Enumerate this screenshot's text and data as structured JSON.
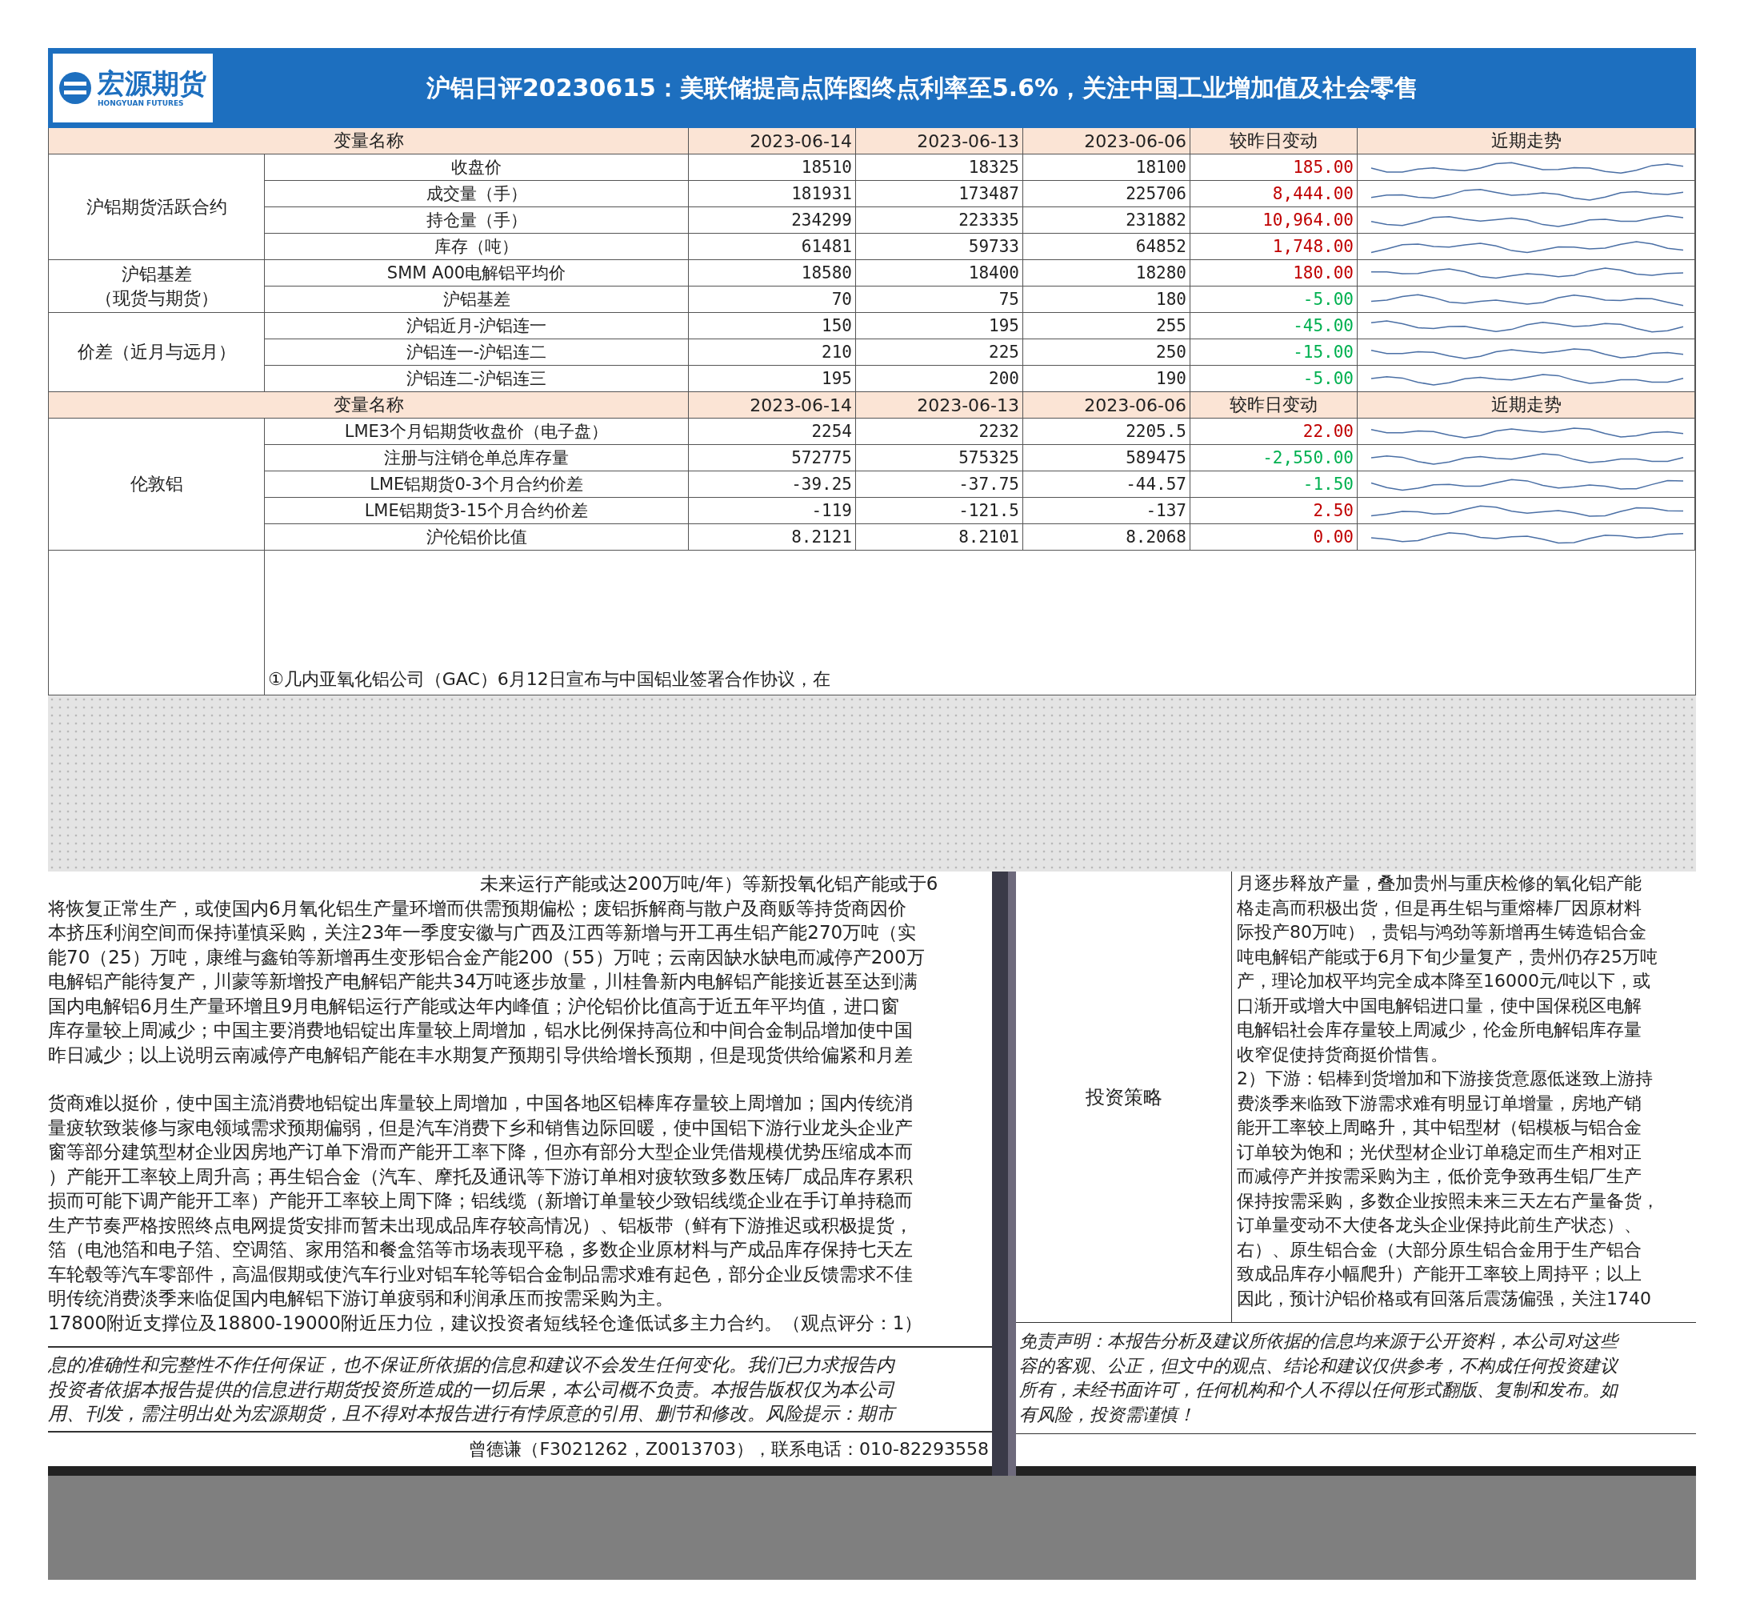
{
  "header": {
    "logo": {
      "name": "宏源期货",
      "subtitle": "HONGYUAN FUTURES"
    },
    "title": "沪铝日评20230615：美联储提高点阵图终点利率至5.6%，关注中国工业增加值及社会零售"
  },
  "sections": [
    {
      "columns": [
        "变量名称",
        "2023-06-14",
        "2023-06-13",
        "2023-06-06",
        "较昨日变动",
        "近期走势"
      ],
      "groups": [
        {
          "label": [
            "沪铝期货活跃合约"
          ],
          "rows": [
            {
              "name": "收盘价",
              "values": [
                "18510",
                "18325",
                "18100"
              ],
              "change": "185.00",
              "color": "#c00000"
            },
            {
              "name": "成交量（手）",
              "values": [
                "181931",
                "173487",
                "225706"
              ],
              "change": "8,444.00",
              "color": "#c00000"
            },
            {
              "name": "持仓量（手）",
              "values": [
                "234299",
                "223335",
                "231882"
              ],
              "change": "10,964.00",
              "color": "#c00000"
            },
            {
              "name": "库存（吨）",
              "values": [
                "61481",
                "59733",
                "64852"
              ],
              "change": "1,748.00",
              "color": "#c00000"
            }
          ]
        },
        {
          "label": [
            "沪铝基差",
            "（现货与期货）"
          ],
          "rows": [
            {
              "name": "SMM A00电解铝平均价",
              "values": [
                "18580",
                "18400",
                "18280"
              ],
              "change": "180.00",
              "color": "#c00000"
            },
            {
              "name": "沪铝基差",
              "values": [
                "70",
                "75",
                "180"
              ],
              "change": "-5.00",
              "color": "#00b050"
            }
          ]
        },
        {
          "label": [
            "价差（近月与远月）"
          ],
          "rows": [
            {
              "name": "沪铝近月-沪铝连一",
              "values": [
                "150",
                "195",
                "255"
              ],
              "change": "-45.00",
              "color": "#00b050"
            },
            {
              "name": "沪铝连一-沪铝连二",
              "values": [
                "210",
                "225",
                "250"
              ],
              "change": "-15.00",
              "color": "#00b050"
            },
            {
              "name": "沪铝连二-沪铝连三",
              "values": [
                "195",
                "200",
                "190"
              ],
              "change": "-5.00",
              "color": "#00b050"
            }
          ]
        }
      ]
    },
    {
      "columns": [
        "变量名称",
        "2023-06-14",
        "2023-06-13",
        "2023-06-06",
        "较昨日变动",
        "近期走势"
      ],
      "groups": [
        {
          "label": [
            "伦敦铝"
          ],
          "rows": [
            {
              "name": "LME3个月铝期货收盘价（电子盘）",
              "values": [
                "2254",
                "2232",
                "2205.5"
              ],
              "change": "22.00",
              "color": "#c00000"
            },
            {
              "name": "注册与注销仓单总库存量",
              "values": [
                "572775",
                "575325",
                "589475"
              ],
              "change": "-2,550.00",
              "color": "#00b050"
            },
            {
              "name": "LME铝期货0-3个月合约价差",
              "values": [
                "-39.25",
                "-37.75",
                "-44.57"
              ],
              "change": "-1.50",
              "color": "#00b050"
            },
            {
              "name": "LME铝期货3-15个月合约价差",
              "values": [
                "-119",
                "-121.5",
                "-137"
              ],
              "change": "2.50",
              "color": "#c00000"
            },
            {
              "name": "沪伦铝价比值",
              "values": [
                "8.2121",
                "8.2101",
                "8.2068"
              ],
              "change": "0.00",
              "color": "#c00000"
            }
          ]
        }
      ]
    }
  ],
  "commentary": {
    "first_line": "①几内亚氧化铝公司（GAC）6月12日宣布与中国铝业签署合作协议，在"
  },
  "left_pane": {
    "partial_line": "未来运行产能或达200万吨/年）等新投氧化铝产能或于6",
    "paragraphs": [
      [
        "将恢复正常生产，或使国内6月氧化铝生产量环增而供需预期偏松；废铝拆解商与散户及商贩等持货商因价",
        "本挤压利润空间而保持谨慎采购，关注23年一季度安徽与广西及江西等新增与开工再生铝产能270万吨（实",
        "能70（25）万吨，康维与鑫铂等新增再生变形铝合金产能200（55）万吨；云南因缺水缺电而减停产200万",
        "电解铝产能待复产，川蒙等新增投产电解铝产能共34万吨逐步放量，川桂鲁新内电解铝产能接近甚至达到满",
        "国内电解铝6月生产量环增且9月电解铝运行产能或达年内峰值；沪伦铝价比值高于近五年平均值，进口窗",
        "库存量较上周减少；中国主要消费地铝锭出库量较上周增加，铝水比例保持高位和中间合金制品增加使中国",
        "昨日减少；以上说明云南减停产电解铝产能在丰水期复产预期引导供给增长预期，但是现货供给偏紧和月差"
      ],
      [
        "货商难以挺价，使中国主流消费地铝锭出库量较上周增加，中国各地区铝棒库存量较上周增加；国内传统消",
        "量疲软致装修与家电领域需求预期偏弱，但是汽车消费下乡和销售边际回暖，使中国铝下游行业龙头企业产",
        "窗等部分建筑型材企业因房地产订单下滑而产能开工率下降，但亦有部分大型企业凭借规模优势压缩成本而",
        "）产能开工率较上周升高；再生铝合金（汽车、摩托及通讯等下游订单相对疲软致多数压铸厂成品库存累积",
        "损而可能下调产能开工率）产能开工率较上周下降；铝线缆（新增订单量较少致铝线缆企业在手订单持稳而",
        "生产节奏严格按照终点电网提货安排而暂未出现成品库存较高情况）、铝板带（鲜有下游推迟或积极提货，",
        "箔（电池箔和电子箔、空调箔、家用箔和餐盒箔等市场表现平稳，多数企业原材料与产成品库存保持七天左",
        "车轮毂等汽车零部件，高温假期或使汽车行业对铝车轮等铝合金制品需求难有起色，部分企业反馈需求不佳",
        "明传统消费淡季来临促国内电解铝下游订单疲弱和利润承压而按需采购为主。",
        "17800附近支撑位及18800-19000附近压力位，建议投资者短线轻仓逢低试多主力合约。（观点评分：1）"
      ]
    ],
    "disclaimer": [
      "息的准确性和完整性不作任何保证，也不保证所依据的信息和建议不会发生任何变化。我们已力求报告内",
      "投资者依据本报告提供的信息进行期货投资所造成的一切后果，本公司概不负责。本报告版权仅为本公司",
      "用、刊发，需注明出处为宏源期货，且不得对本报告进行有悖原意的引用、删节和修改。风险提示：期市"
    ],
    "contact": "曾德谦（F3021262，Z0013703），联系电话：010-82293558"
  },
  "right_pane": {
    "label": "投资策略",
    "lines": [
      "月逐步释放产量，叠加贵州与重庆检修的氧化铝产能",
      "格走高而积极出货，但是再生铝与重熔棒厂因原材料",
      "际投产80万吨），贵铝与鸿劲等新增再生铸造铝合金",
      "吨电解铝产能或于6月下旬少量复产，贵州仍存25万吨",
      "产，理论加权平均完全成本降至16000元/吨以下，或",
      "口渐开或增大中国电解铝进口量，使中国保税区电解",
      "电解铝社会库存量较上周减少，伦金所电解铝库存量",
      "收窄促使持货商挺价惜售。",
      "2）下游：铝棒到货增加和下游接货意愿低迷致上游持",
      "费淡季来临致下游需求难有明显订单增量，房地产销",
      "能开工率较上周略升，其中铝型材（铝模板与铝合金",
      "订单较为饱和；光伏型材企业订单稳定而生产相对正",
      "而减停产并按需采购为主，低价竞争致再生铝厂生产",
      "保持按需采购，多数企业按照未来三天左右产量备货，",
      "订单量变动不大使各龙头企业保持此前生产状态）、",
      "右）、原生铝合金（大部分原生铝合金用于生产铝合",
      "致成品库存小幅爬升）产能开工率较上周持平；以上",
      "因此，预计沪铝价格或有回落后震荡偏强，关注1740"
    ],
    "disclaimer": [
      "免责声明：本报告分析及建议所依据的信息均来源于公开资料，本公司对这些",
      "容的客观、公正，但文中的观点、结论和建议仅供参考，不构成任何投资建议",
      "所有，未经书面许可，任何机构和个人不得以任何形式翻版、复制和发布。如",
      "有风险，投资需谨慎！"
    ]
  }
}
